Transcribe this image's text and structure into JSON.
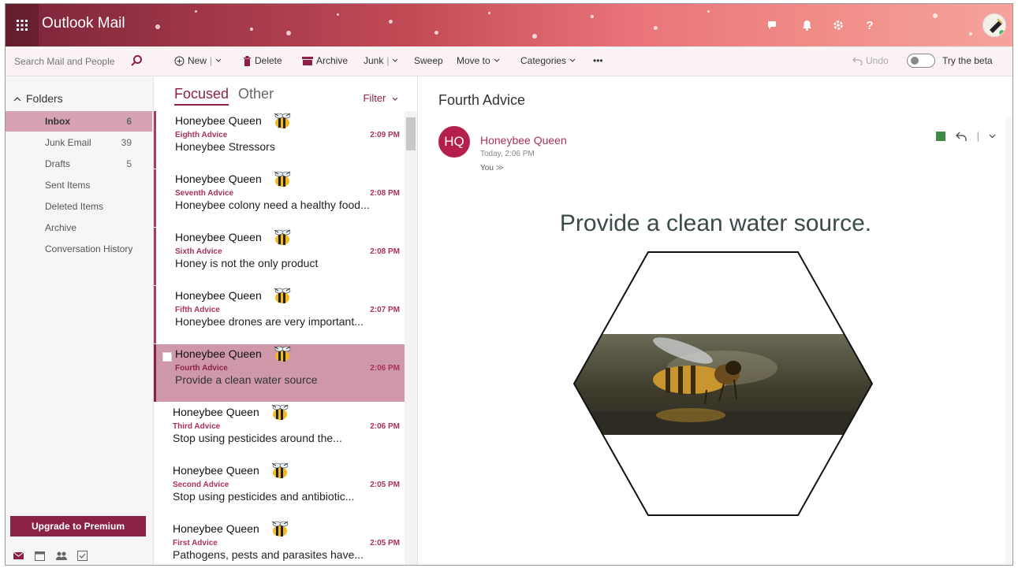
{
  "app": {
    "brand": "Outlook Mail",
    "help_label": "?"
  },
  "toolbar": {
    "search_placeholder": "Search Mail and People",
    "new_label": "New",
    "delete_label": "Delete",
    "archive_label": "Archive",
    "junk_label": "Junk",
    "sweep_label": "Sweep",
    "move_label": "Move to",
    "categories_label": "Categories",
    "more_label": "•••",
    "undo_label": "Undo",
    "beta_label": "Try the beta"
  },
  "nav": {
    "folders_label": "Folders",
    "items": [
      {
        "label": "Inbox",
        "count": "6"
      },
      {
        "label": "Junk Email",
        "count": "39"
      },
      {
        "label": "Drafts",
        "count": "5"
      },
      {
        "label": "Sent Items",
        "count": ""
      },
      {
        "label": "Deleted Items",
        "count": ""
      },
      {
        "label": "Archive",
        "count": ""
      },
      {
        "label": "Conversation History",
        "count": ""
      }
    ],
    "upgrade_label": "Upgrade to Premium"
  },
  "list": {
    "tab_focused": "Focused",
    "tab_other": "Other",
    "filter_label": "Filter",
    "messages": [
      {
        "sender": "Honeybee Queen",
        "subject": "Eighth Advice",
        "time": "2:09 PM",
        "preview": "Honeybee Stressors"
      },
      {
        "sender": "Honeybee Queen",
        "subject": "Seventh Advice",
        "time": "2:08 PM",
        "preview": "Honeybee colony need a healthy food..."
      },
      {
        "sender": "Honeybee Queen",
        "subject": "Sixth Advice",
        "time": "2:08 PM",
        "preview": "Honey is not the only product"
      },
      {
        "sender": "Honeybee Queen",
        "subject": "Fifth Advice",
        "time": "2:07 PM",
        "preview": "Honeybee drones are very important..."
      },
      {
        "sender": "Honeybee Queen",
        "subject": "Fourth Advice",
        "time": "2:06 PM",
        "preview": "Provide a clean water source"
      },
      {
        "sender": "Honeybee Queen",
        "subject": "Third Advice",
        "time": "2:06 PM",
        "preview": "Stop using pesticides around the..."
      },
      {
        "sender": "Honeybee Queen",
        "subject": "Second Advice",
        "time": "2:05 PM",
        "preview": "Stop using pesticides and antibiotic..."
      },
      {
        "sender": "Honeybee Queen",
        "subject": "First Advice",
        "time": "2:05 PM",
        "preview": "Pathogens, pests and parasites have..."
      }
    ]
  },
  "reading": {
    "title": "Fourth Advice",
    "avatar_initials": "HQ",
    "sender": "Honeybee Queen",
    "date": "Today, 2:06 PM",
    "to": "You",
    "heading": "Provide a clean water source."
  },
  "colors": {
    "accent": "#8b2246",
    "selected_row": "#cf98a9",
    "avatar": "#b5204b"
  }
}
